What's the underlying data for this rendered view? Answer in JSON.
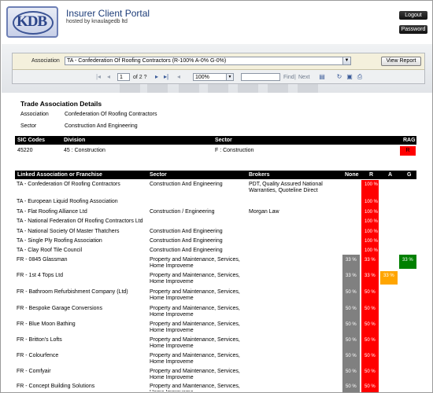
{
  "header": {
    "logo_text": "KDB",
    "title": "Insurer Client Portal",
    "subtitle": "hosted by knaulagedb ltd",
    "logout_label": "Logout",
    "password_label": "Password"
  },
  "report_controls": {
    "association_label": "Association",
    "association_value": "TA - Confederation Of Roofing Contractors (R-100%  A-0%  G-0%)",
    "view_report_label": "View Report",
    "page_current": "1",
    "page_of": "of 2 ?",
    "zoom_value": "100%",
    "find_label": "Find",
    "next_label": "Next",
    "find_separator": "|"
  },
  "trade_details": {
    "title": "Trade Association Details",
    "association_label": "Association",
    "association_value": "Confederation Of Roofing Contractors",
    "sector_label": "Sector",
    "sector_value": "Construction And Engineering"
  },
  "sic_table": {
    "headers": [
      "SIC Codes",
      "Division",
      "Sector",
      "RAG"
    ],
    "row": {
      "code": "45220",
      "division": "45 : Construction",
      "sector": "F : Construction",
      "rag": "R",
      "rag_color": "#ff0000"
    }
  },
  "linked_table": {
    "headers": [
      "Linked Association or Franchise",
      "Sector",
      "Brokers",
      "None",
      "R",
      "A",
      "G"
    ],
    "rows": [
      {
        "name": "TA - Confederation Of Roofing Contractors",
        "sector": "Construction And Engineering",
        "brokers": "PDT, Quality Assured National Warranties, Quoteline Direct",
        "none": "",
        "r": "100 %",
        "a": "",
        "g": ""
      },
      {
        "name": "TA - European Liquid Roofing Association",
        "sector": "",
        "brokers": "",
        "none": "",
        "r": "100 %",
        "a": "",
        "g": ""
      },
      {
        "name": "TA - Flat Roofing Alliance Ltd",
        "sector": "Construction / Engineering",
        "brokers": "Morgan Law",
        "none": "",
        "r": "100 %",
        "a": "",
        "g": ""
      },
      {
        "name": "TA - National Federation Of Roofing Contractors Ltd",
        "sector": "",
        "brokers": "",
        "none": "",
        "r": "100 %",
        "a": "",
        "g": ""
      },
      {
        "name": "TA - National Society Of Master Thatchers",
        "sector": "Construction And Engineering",
        "brokers": "",
        "none": "",
        "r": "100 %",
        "a": "",
        "g": ""
      },
      {
        "name": "TA - Single Ply Roofing Association",
        "sector": "Construction And Engineering",
        "brokers": "",
        "none": "",
        "r": "100 %",
        "a": "",
        "g": ""
      },
      {
        "name": "TA - Clay Roof Tile Council",
        "sector": "Construction And Engineering",
        "brokers": "",
        "none": "",
        "r": "100 %",
        "a": "",
        "g": ""
      },
      {
        "name": "FR - 0845 Glassman",
        "sector": "Property and Maintenance, Services, Home Improveme",
        "brokers": "",
        "none": "33 %",
        "r": "33 %",
        "a": "",
        "g": "33 %"
      },
      {
        "name": "FR - 1st 4 Tops Ltd",
        "sector": "Property and Maintenance, Services, Home Improveme",
        "brokers": "",
        "none": "33 %",
        "r": "33 %",
        "a": "33 %",
        "g": ""
      },
      {
        "name": "FR - Bathroom Refurbishment Company (Ltd)",
        "sector": "Property and Maintenance, Services, Home Improveme",
        "brokers": "",
        "none": "50 %",
        "r": "50 %",
        "a": "",
        "g": ""
      },
      {
        "name": "FR - Bespoke Garage Conversions",
        "sector": "Property and Maintenance, Services, Home Improveme",
        "brokers": "",
        "none": "50 %",
        "r": "50 %",
        "a": "",
        "g": ""
      },
      {
        "name": "FR - Blue Moon Bathing",
        "sector": "Property and Maintenance, Services, Home Improveme",
        "brokers": "",
        "none": "50 %",
        "r": "50 %",
        "a": "",
        "g": ""
      },
      {
        "name": "FR - Britton's Lofts",
        "sector": "Property and Maintenance, Services, Home Improveme",
        "brokers": "",
        "none": "50 %",
        "r": "50 %",
        "a": "",
        "g": ""
      },
      {
        "name": "FR - Colourfence",
        "sector": "Property and Maintenance, Services, Home Improveme",
        "brokers": "",
        "none": "50 %",
        "r": "50 %",
        "a": "",
        "g": ""
      },
      {
        "name": "FR - Comfyair",
        "sector": "Property and Maintenance, Services, Home Improveme",
        "brokers": "",
        "none": "50 %",
        "r": "50 %",
        "a": "",
        "g": ""
      },
      {
        "name": "FR - Concept Building Solutions",
        "sector": "Property and Maintenance, Services, Home Improveme",
        "brokers": "",
        "none": "50 %",
        "r": "50 %",
        "a": "",
        "g": ""
      }
    ]
  },
  "colors": {
    "red": "#ff0000",
    "amber": "#ffa500",
    "green": "#008000",
    "none_grey": "#808080",
    "title_blue": "#1c3c78"
  },
  "icons": [
    "first-page-icon",
    "prev-page-icon",
    "next-page-icon",
    "last-page-icon",
    "back-icon",
    "export-icon",
    "refresh-icon",
    "print-layout-icon",
    "print-icon"
  ]
}
